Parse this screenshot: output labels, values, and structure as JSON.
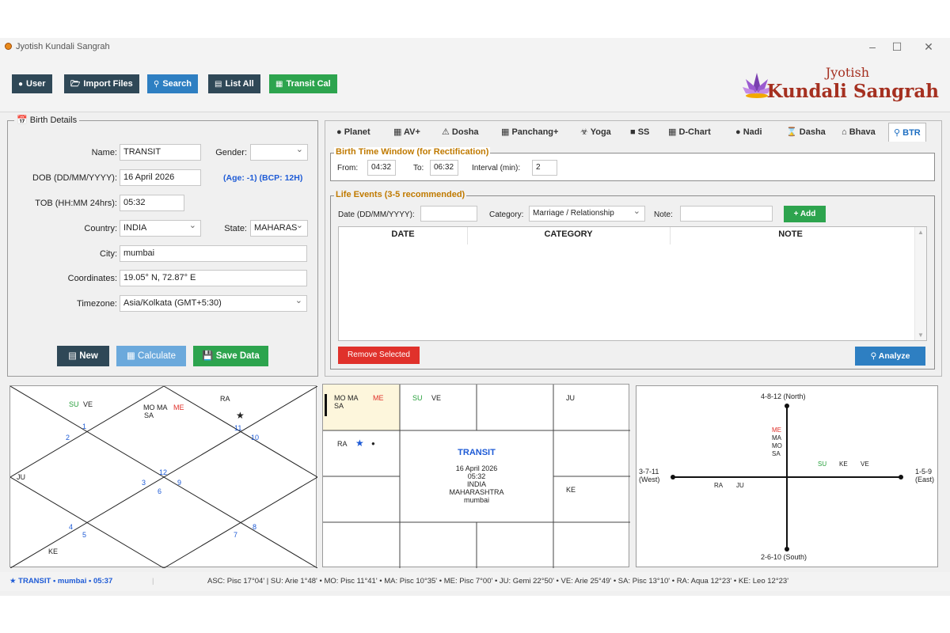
{
  "window": {
    "title": "Jyotish Kundali Sangrah",
    "min": "–",
    "max": "☐",
    "close": "✕"
  },
  "toolbar": {
    "user": "User",
    "import": "Import Files",
    "search": "Search",
    "list_all": "List All",
    "transit": "Transit Cal"
  },
  "logo": {
    "sub": "Jyotish",
    "main": "Kundali Sangrah"
  },
  "birth": {
    "title": "Birth Details",
    "name_label": "Name:",
    "name": "TRANSIT",
    "gender_label": "Gender:",
    "gender": "",
    "dob_label": "DOB (DD/MM/YYYY):",
    "dob": "16 April 2026",
    "age": "(Age: -1) (BCP: 12H)",
    "tob_label": "TOB (HH:MM 24hrs):",
    "tob": "05:32",
    "country_label": "Country:",
    "country": "INDIA",
    "state_label": "State:",
    "state": "MAHARAS",
    "city_label": "City:",
    "city": "mumbai",
    "coords_label": "Coordinates:",
    "coords": "19.05° N, 72.87° E",
    "tz_label": "Timezone:",
    "tz": "Asia/Kolkata (GMT+5:30)",
    "new": "New",
    "calculate": "Calculate",
    "save": "Save Data"
  },
  "tabs": [
    "Planet",
    "AV+",
    "Dosha",
    "Panchang+",
    "Yoga",
    "SS",
    "D-Chart",
    "Nadi",
    "Dasha",
    "Bhava",
    "BTR"
  ],
  "btr": {
    "window_title": "Birth Time Window (for Rectification)",
    "from_label": "From:",
    "from": "04:32",
    "to_label": "To:",
    "to": "06:32",
    "interval_label": "Interval (min):",
    "interval": "2",
    "events_title": "Life Events (3-5 recommended)",
    "date_label": "Date (DD/MM/YYYY):",
    "date": "",
    "category_label": "Category:",
    "category": "Marriage / Relationship",
    "note_label": "Note:",
    "note": "",
    "add": "+ Add",
    "col_date": "DATE",
    "col_category": "CATEGORY",
    "col_note": "NOTE",
    "remove": "Remove Selected",
    "analyze": "Analyze"
  },
  "north_chart": {
    "houses": [
      "1",
      "2",
      "3",
      "4",
      "5",
      "6",
      "7",
      "8",
      "9",
      "10",
      "11",
      "12"
    ],
    "su": "SU",
    "ve": "VE",
    "mo_ma": "MO MA",
    "me": "ME",
    "sa": "SA",
    "ra": "RA",
    "ju": "JU",
    "ke": "KE",
    "star": "★"
  },
  "south_chart": {
    "mo_ma": "MO  MA",
    "me": "ME",
    "sa": "SA",
    "su": "SU",
    "ve": "VE",
    "ju": "JU",
    "ra": "RA",
    "star": "★",
    "dot": "●",
    "ke": "KE",
    "center_title": "TRANSIT",
    "center_date": "16 April 2026",
    "center_time": "05:32",
    "center_country": "INDIA",
    "center_state": "MAHARASHTRA",
    "center_city": "mumbai"
  },
  "cross_chart": {
    "north": "4-8-12 (North)",
    "south": "2-6-10 (South)",
    "west": "3-7-11",
    "west2": "(West)",
    "east": "1-5-9",
    "east2": "(East)",
    "me": "ME",
    "ma": "MA",
    "mo": "MO",
    "sa": "SA",
    "su": "SU",
    "ke": "KE",
    "ve": "VE",
    "ra": "RA",
    "ju": "JU"
  },
  "status": {
    "left": "★ TRANSIT • mumbai • 05:37",
    "right": "ASC: Pisc 17°04'  |  SU: Arie 1°48'  •  MO: Pisc 11°41'  •  MA: Pisc 10°35'  •  ME: Pisc 7°00'  •  JU: Gemi 22°50'  •  VE: Arie 25°49'  •  SA: Pisc 13°10'  •  RA: Aqua 12°23'  •  KE: Leo 12°23'"
  },
  "colors": {
    "accent_blue": "#2e7fc2",
    "dark_btn": "#2f4857",
    "green": "#2da44e",
    "red": "#e0312b",
    "group_title": "#c07a00",
    "logo": "#a53020"
  }
}
